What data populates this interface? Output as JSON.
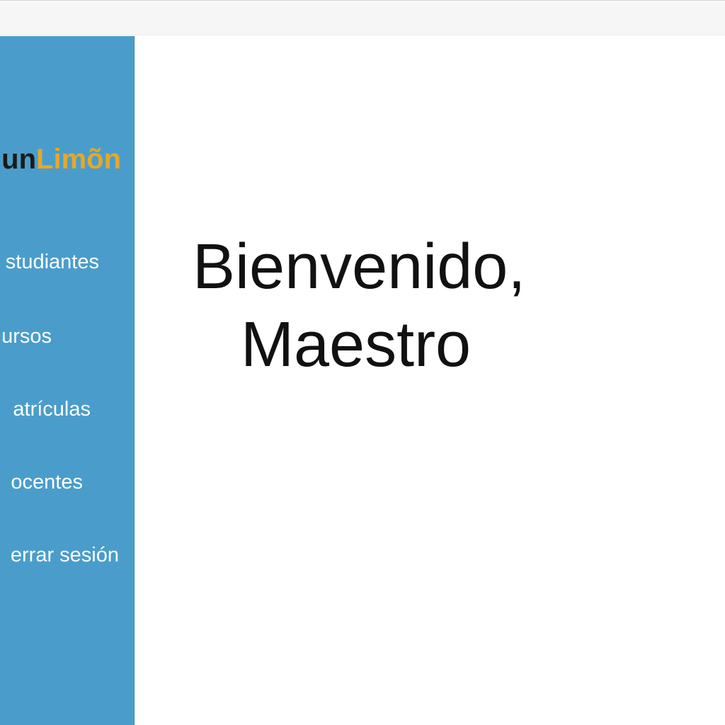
{
  "brand": {
    "part1": "un",
    "part2": "Limõn"
  },
  "nav": {
    "items": [
      {
        "label": "studiantes"
      },
      {
        "label": "ursos"
      },
      {
        "label": "atrículas"
      },
      {
        "label": "ocentes"
      },
      {
        "label": "errar sesión"
      }
    ]
  },
  "welcome": {
    "line1": "Bienvenido,",
    "line2": "Maestro"
  },
  "colors": {
    "sidebar": "#4a9dcb",
    "brand_accent": "#e5a82a",
    "brand_dark": "#1a1a1a"
  }
}
